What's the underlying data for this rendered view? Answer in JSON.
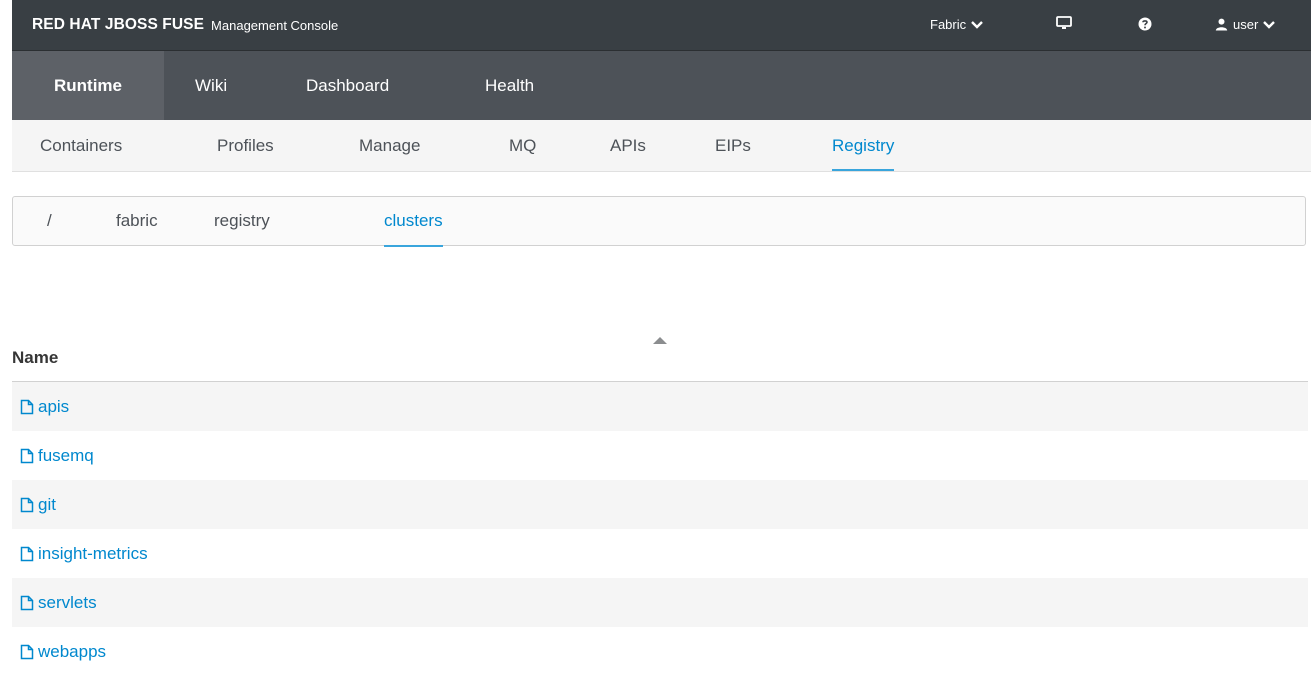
{
  "header": {
    "brand": "RED HAT JBOSS FUSE",
    "subtitle": "Management Console",
    "fabric_label": "Fabric",
    "user_label": "user"
  },
  "primary_nav": [
    "Runtime",
    "Wiki",
    "Dashboard",
    "Health"
  ],
  "secondary_nav": [
    "Containers",
    "Profiles",
    "Manage",
    "MQ",
    "APIs",
    "EIPs",
    "Registry"
  ],
  "breadcrumbs": [
    "/",
    "fabric",
    "registry",
    "clusters"
  ],
  "table": {
    "header": "Name",
    "rows": [
      "apis",
      "fusemq",
      "git",
      "insight-metrics",
      "servlets",
      "webapps"
    ]
  },
  "icons": {
    "chevron": "chevron-down-icon",
    "display": "desktop-icon",
    "help": "question-circle-icon",
    "user": "user-icon",
    "file": "file-outline-icon",
    "sort": "sort-ascending-icon"
  },
  "colors": {
    "topbar": "#393f44",
    "primary_nav": "#4d5258",
    "accent": "#0088ce"
  }
}
